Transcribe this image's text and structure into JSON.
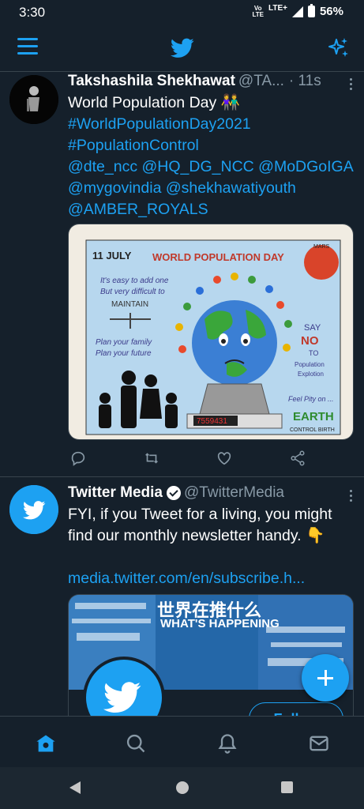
{
  "status": {
    "time": "3:30",
    "volte": "Vo\nLTE",
    "network": "LTE+",
    "battery": "56%"
  },
  "appbar": {
    "menu_icon": "hamburger-menu-icon",
    "logo_icon": "twitter-bird-icon",
    "sparkle_icon": "sparkle-icon"
  },
  "tweets": [
    {
      "name": "Takshashila Shekhawat",
      "handle": "@TA...",
      "time": "· 11s",
      "line1": "World Population Day 👫",
      "tags": [
        "#WorldPopulationDay2021",
        "#PopulationControl",
        "@dte_ncc @HQ_DG_NCC @MoDGoIGA",
        "@mygovindia @shekhawatiyouth",
        "@AMBER_ROYALS"
      ],
      "image": {
        "date": "11 JULY",
        "title": "WORLD POPULATION DAY",
        "left1": "It's easy to add one",
        "left2": "But very difficult to",
        "left3": "MAINTAIN",
        "left4": "Plan your family",
        "left5": "Plan your future",
        "say": "SAY",
        "no": "NO",
        "to": "TO",
        "pop1": "Population",
        "pop2": "Explotion",
        "feel": "Feel Pity on ...",
        "earth": "EARTH",
        "control": "CONTROL BIRTH",
        "counter": "7559431",
        "mars": "MARS"
      }
    },
    {
      "name": "Twitter Media",
      "handle": "@TwitterMedia",
      "text": "FYI, if you Tweet for a living, you might find our monthly newsletter handy. 👇",
      "link": "media.twitter.com/en/subscribe.h...",
      "card": {
        "jp": "世界在推什么",
        "what": "WHAT'S HAPPENING",
        "follow": "Follow"
      }
    }
  ],
  "bottomnav": [
    "home-icon",
    "search-icon",
    "notifications-bell-icon",
    "messages-icon"
  ],
  "colors": {
    "bg": "#15202b",
    "accent": "#1da1f2",
    "muted": "#8899a6",
    "border": "#38444d"
  }
}
